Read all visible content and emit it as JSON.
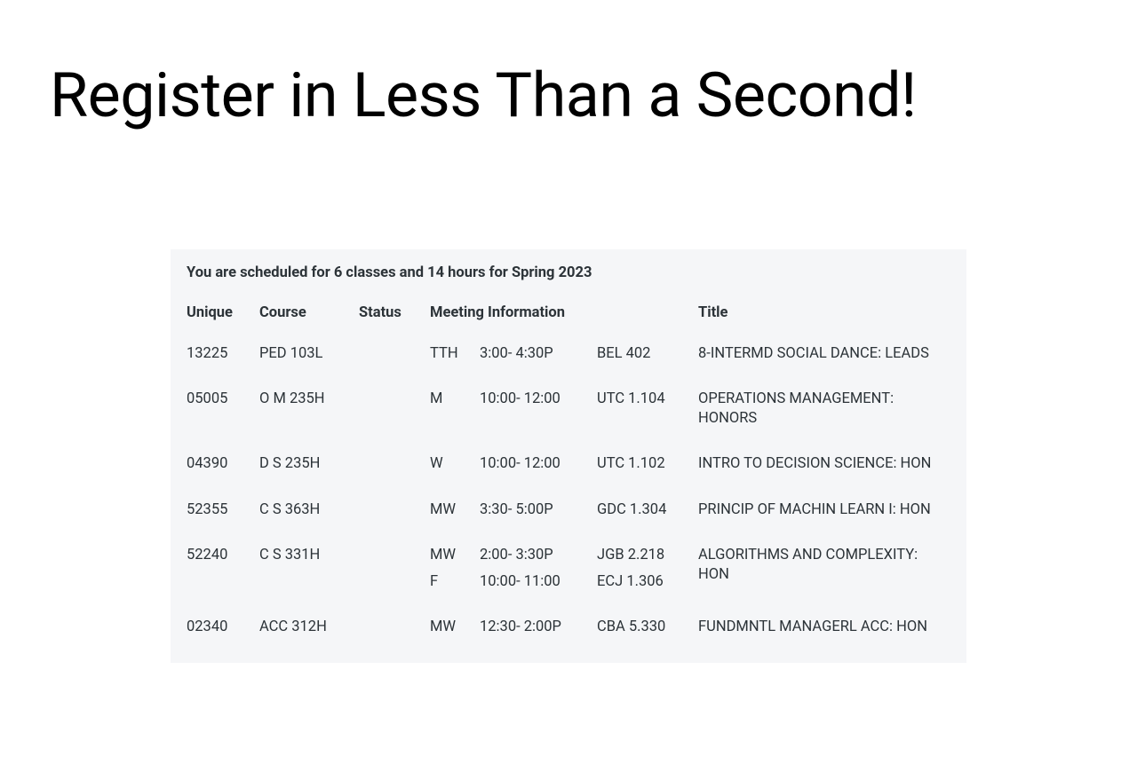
{
  "heading": "Register in Less Than a Second!",
  "summary": "You are scheduled for 6 classes and 14 hours for Spring 2023",
  "columns": {
    "unique": "Unique",
    "course": "Course",
    "status": "Status",
    "meeting": "Meeting Information",
    "title": "Title"
  },
  "rows": [
    {
      "unique": "13225",
      "course": "PED 103L",
      "status": "",
      "meetings": [
        {
          "days": "TTH",
          "time": "3:00- 4:30P",
          "room": "BEL 402"
        }
      ],
      "title": "8-INTERMD SOCIAL DANCE: LEADS"
    },
    {
      "unique": "05005",
      "course": "O M 235H",
      "status": "",
      "meetings": [
        {
          "days": "M",
          "time": "10:00- 12:00",
          "room": "UTC 1.104"
        }
      ],
      "title": "OPERATIONS MANAGEMENT: HONORS"
    },
    {
      "unique": "04390",
      "course": "D S 235H",
      "status": "",
      "meetings": [
        {
          "days": "W",
          "time": "10:00- 12:00",
          "room": "UTC 1.102"
        }
      ],
      "title": "INTRO TO DECISION SCIENCE: HON"
    },
    {
      "unique": "52355",
      "course": "C S 363H",
      "status": "",
      "meetings": [
        {
          "days": "MW",
          "time": "3:30- 5:00P",
          "room": "GDC 1.304"
        }
      ],
      "title": "PRINCIP OF MACHIN LEARN I: HON"
    },
    {
      "unique": "52240",
      "course": "C S 331H",
      "status": "",
      "meetings": [
        {
          "days": "MW",
          "time": "2:00- 3:30P",
          "room": "JGB 2.218"
        },
        {
          "days": "F",
          "time": "10:00- 11:00",
          "room": "ECJ 1.306"
        }
      ],
      "title": "ALGORITHMS AND COMPLEXITY: HON"
    },
    {
      "unique": "02340",
      "course": "ACC 312H",
      "status": "",
      "meetings": [
        {
          "days": "MW",
          "time": "12:30- 2:00P",
          "room": "CBA 5.330"
        }
      ],
      "title": "FUNDMNTL MANAGERL ACC: HON"
    }
  ]
}
